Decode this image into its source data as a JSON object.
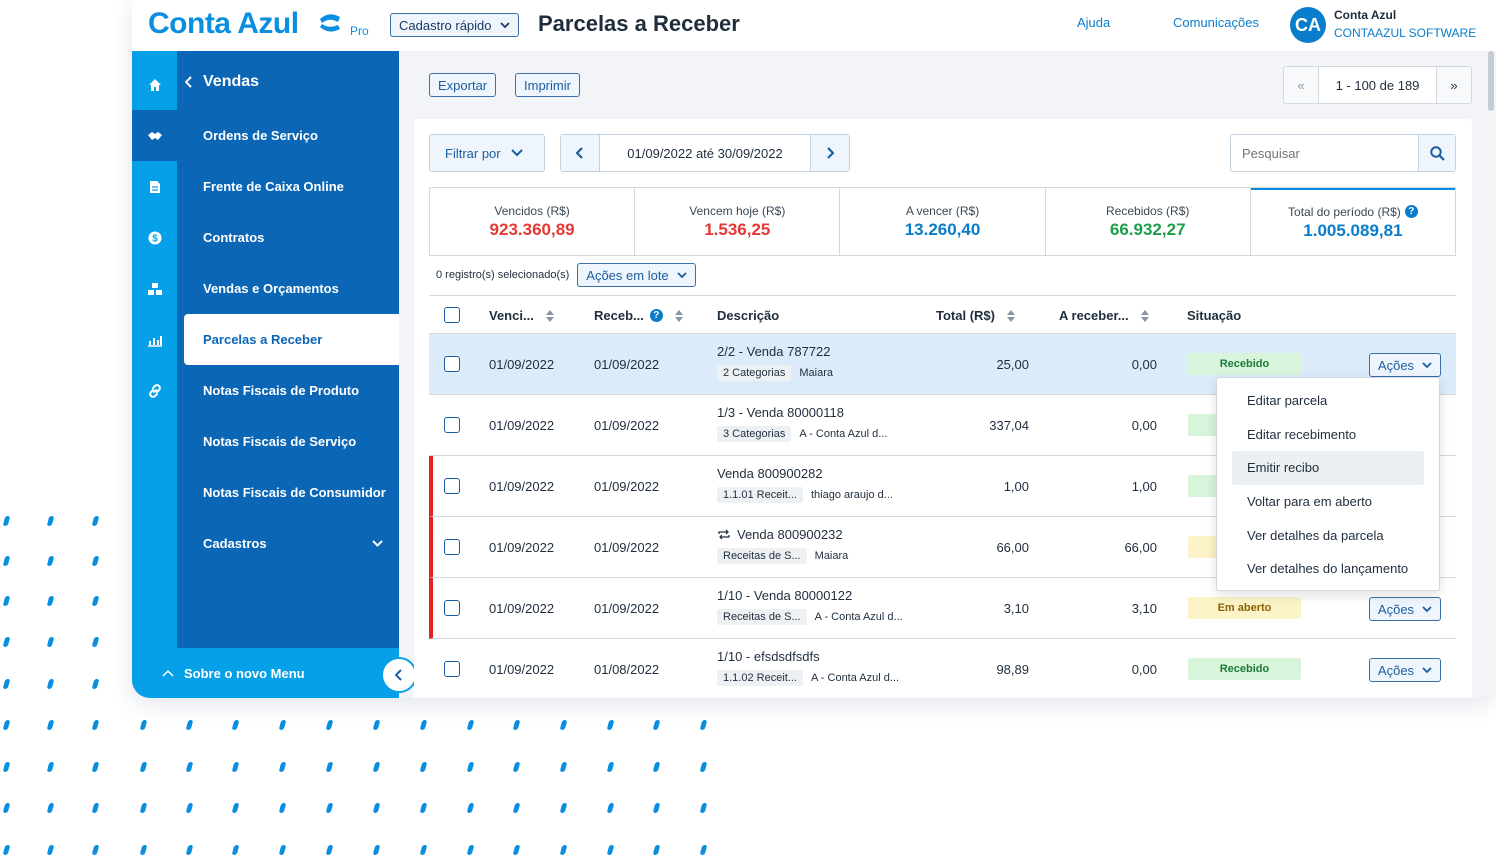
{
  "header": {
    "brand": "Conta Azul",
    "plan": "Pro",
    "quick_register": "Cadastro rápido",
    "page_title": "Parcelas a Receber",
    "help": "Ajuda",
    "communications": "Comunicações",
    "avatar": "CA",
    "user_name": "Conta Azul",
    "company": "CONTAAZUL SOFTWARE"
  },
  "sidebar": {
    "section": "Vendas",
    "items": [
      {
        "label": "Ordens de Serviço"
      },
      {
        "label": "Frente de Caixa Online"
      },
      {
        "label": "Contratos"
      },
      {
        "label": "Vendas e Orçamentos"
      },
      {
        "label": "Parcelas a Receber"
      },
      {
        "label": "Notas Fiscais de Produto"
      },
      {
        "label": "Notas Fiscais de Serviço"
      },
      {
        "label": "Notas Fiscais de Consumidor"
      },
      {
        "label": "Cadastros"
      }
    ],
    "footer": "Sobre o novo Menu"
  },
  "toolbar": {
    "export": "Exportar",
    "print": "Imprimir",
    "pager_first": "«",
    "pager_label": "1 - 100 de 189",
    "pager_last": "»"
  },
  "filters": {
    "filter_by": "Filtrar por",
    "date_range": "01/09/2022 até 30/09/2022",
    "search_placeholder": "Pesquisar"
  },
  "totals": [
    {
      "label": "Vencidos (R$)",
      "value": "923.360,89",
      "color": "#e53935"
    },
    {
      "label": "Vencem hoje (R$)",
      "value": "1.536,25",
      "color": "#e53935"
    },
    {
      "label": "A vencer (R$)",
      "value": "13.260,40",
      "color": "#0a7ccc"
    },
    {
      "label": "Recebidos (R$)",
      "value": "66.932,27",
      "color": "#1e9e4a"
    },
    {
      "label": "Total do período (R$)",
      "value": "1.005.089,81",
      "color": "#0a7ccc"
    }
  ],
  "selection": {
    "count_text": "0 registro(s) selecionado(s)",
    "bulk_actions": "Ações em lote"
  },
  "table": {
    "headers": {
      "due": "Venci...",
      "received": "Receb...",
      "description": "Descrição",
      "total": "Total (R$)",
      "to_receive": "A receber...",
      "status": "Situação"
    },
    "rows": [
      {
        "due": "01/09/2022",
        "received": "01/09/2022",
        "title": "2/2 - Venda 787722",
        "tag": "2 Categorias",
        "client": "Maiara",
        "total": "25,00",
        "to_receive": "0,00",
        "status": "Recebido",
        "action": "Ações"
      },
      {
        "due": "01/09/2022",
        "received": "01/09/2022",
        "title": "1/3 - Venda 80000118",
        "tag": "3 Categorias",
        "client": "A - Conta Azul d...",
        "total": "337,04",
        "to_receive": "0,00",
        "status": "",
        "action": ""
      },
      {
        "due": "01/09/2022",
        "received": "01/09/2022",
        "title": "Venda 800900282",
        "tag": "1.1.01 Receit...",
        "client": "thiago araujo d...",
        "total": "1,00",
        "to_receive": "1,00",
        "status": "",
        "action": ""
      },
      {
        "due": "01/09/2022",
        "received": "01/09/2022",
        "title": "Venda 800900232",
        "tag": "Receitas de S...",
        "client": "Maiara",
        "total": "66,00",
        "to_receive": "66,00",
        "status": "",
        "action": ""
      },
      {
        "due": "01/09/2022",
        "received": "01/09/2022",
        "title": "1/10 - Venda 80000122",
        "tag": "Receitas de S...",
        "client": "A - Conta Azul d...",
        "total": "3,10",
        "to_receive": "3,10",
        "status": "Em aberto",
        "action": "Ações"
      },
      {
        "due": "01/09/2022",
        "received": "01/08/2022",
        "title": "1/10 - efsdsdfsdfs",
        "tag": "1.1.02 Receit...",
        "client": "A - Conta Azul d...",
        "total": "98,89",
        "to_receive": "0,00",
        "status": "Recebido",
        "action": "Ações"
      }
    ]
  },
  "actions_menu": [
    "Editar parcela",
    "Editar recebimento",
    "Emitir recibo",
    "Voltar para em aberto",
    "Ver detalhes da parcela",
    "Ver detalhes do lançamento"
  ],
  "colors": {
    "brand_blue": "#0a8fe0",
    "sidebar_dark": "#0b66b6",
    "received_bg": "#d8f5dc",
    "open_bg": "#fdf3c9",
    "overdue_red": "#e02424"
  }
}
